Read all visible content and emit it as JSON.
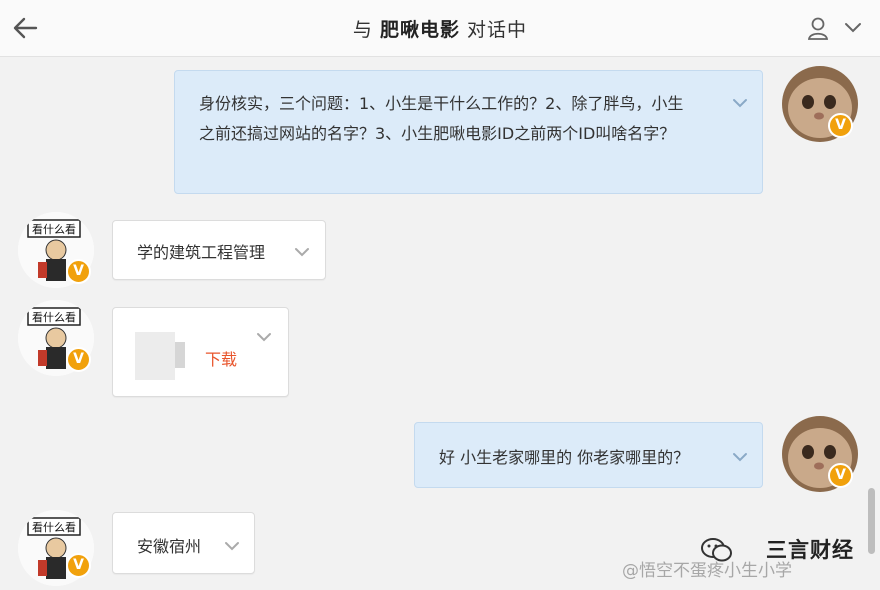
{
  "header": {
    "title_prefix": "与",
    "contact_name": "肥啾电影",
    "title_suffix": "对话中"
  },
  "messages": [
    {
      "direction": "outgoing",
      "text": "身份核实，三个问题：1、小生是干什么工作的？2、除了胖鸟，小生之前还搞过网站的名字？3、小生肥啾电影ID之前两个ID叫啥名字？"
    },
    {
      "direction": "incoming",
      "text": "学的建筑工程管理"
    },
    {
      "direction": "incoming",
      "type": "file",
      "action_label": "下载"
    },
    {
      "direction": "outgoing",
      "text": "好 小生老家哪里的 你老家哪里的？"
    },
    {
      "direction": "incoming",
      "text": "安徽宿州"
    }
  ],
  "badge_letter": "V",
  "avatar_left_caption": "看什么看",
  "watermark": {
    "weibo": "@悟空不蛋疼小生小学",
    "brand": "三言财经"
  },
  "colors": {
    "outgoing_bubble": "#dcebf9",
    "incoming_bubble": "#ffffff",
    "badge": "#f1a10c",
    "download_label": "#e8552c"
  }
}
